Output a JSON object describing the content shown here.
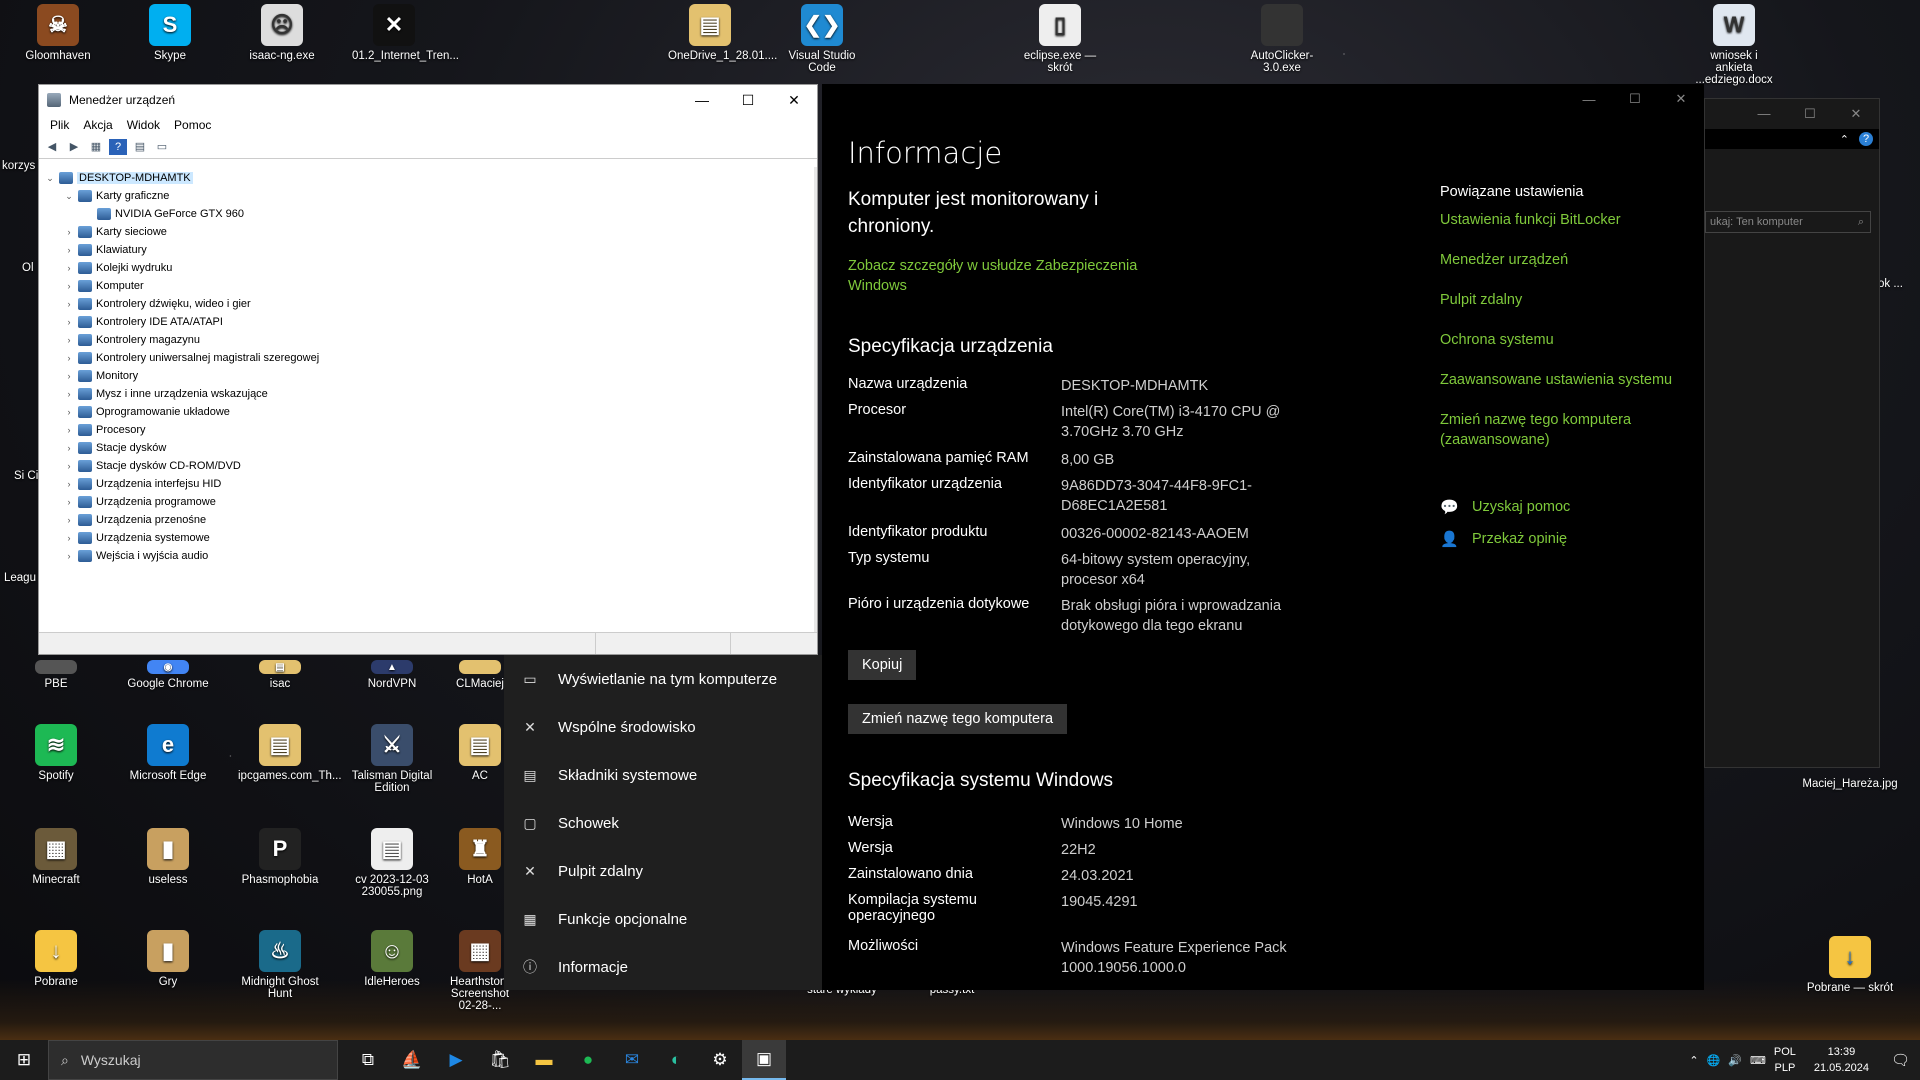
{
  "desktop": {
    "icons_top": [
      {
        "label": "Gloomhaven",
        "glyph": "☠"
      },
      {
        "label": "Skype",
        "glyph": "S"
      },
      {
        "label": "isaac-ng.exe",
        "glyph": "☹"
      },
      {
        "label": "01.2_Internet_Tren...",
        "glyph": "✕"
      },
      {
        "label": "OneDrive_1_28.01....",
        "glyph": "▤"
      },
      {
        "label": "Visual Studio Code",
        "glyph": "❮❯"
      },
      {
        "label": "eclipse.exe — skrót",
        "glyph": "▯"
      },
      {
        "label": "AutoClicker-3.0.exe",
        "glyph": ""
      },
      {
        "label": "wniosek i ankieta ...edziego.docx",
        "glyph": "W"
      }
    ],
    "icons_grid": [
      {
        "label": "PBE",
        "glyph": ""
      },
      {
        "label": "Google Chrome",
        "glyph": "◉"
      },
      {
        "label": "isac",
        "glyph": "▤"
      },
      {
        "label": "NordVPN",
        "glyph": "▲"
      },
      {
        "label": "CLMaciej",
        "glyph": ""
      },
      {
        "label": "Spotify",
        "glyph": "≋"
      },
      {
        "label": "Microsoft Edge",
        "glyph": "e"
      },
      {
        "label": "ipcgames.com_Th...",
        "glyph": "▤"
      },
      {
        "label": "Talisman Digital Edition",
        "glyph": "⚔"
      },
      {
        "label": "AC",
        "glyph": "▤"
      },
      {
        "label": "Minecraft",
        "glyph": "▦"
      },
      {
        "label": "useless",
        "glyph": "▮"
      },
      {
        "label": "Phasmophobia",
        "glyph": "P"
      },
      {
        "label": "cv 2023-12-03 230055.png",
        "glyph": "▤"
      },
      {
        "label": "HotA",
        "glyph": "♜"
      },
      {
        "label": "Pobrane",
        "glyph": "↓"
      },
      {
        "label": "Gry",
        "glyph": "▮"
      },
      {
        "label": "Midnight Ghost Hunt",
        "glyph": "♨"
      },
      {
        "label": "IdleHeroes",
        "glyph": "☺"
      },
      {
        "label": "Hearthstone Screenshot 02-28-...",
        "glyph": "▦"
      }
    ],
    "icons_bottom_misc": [
      {
        "label": "stare wykłady"
      },
      {
        "label": "passy.txt"
      }
    ],
    "icons_right": [
      {
        "label": "Maciej_Hareża.jpg"
      },
      {
        "label": "Pobrane — skrót",
        "glyph": "↓"
      }
    ],
    "edge_labels": [
      "korzys",
      "Ol",
      "Si Civ",
      "Leagu",
      "ok ..."
    ]
  },
  "devmgr": {
    "title": "Menedżer urządzeń",
    "menu": [
      "Plik",
      "Akcja",
      "Widok",
      "Pomoc"
    ],
    "tree": [
      {
        "label": "DESKTOP-MDHAMTK",
        "level": 0,
        "expanded": true,
        "selected": true
      },
      {
        "label": "Karty graficzne",
        "level": 1,
        "expanded": true
      },
      {
        "label": "NVIDIA GeForce GTX 960",
        "level": 2
      },
      {
        "label": "Karty sieciowe",
        "level": 1
      },
      {
        "label": "Klawiatury",
        "level": 1
      },
      {
        "label": "Kolejki wydruku",
        "level": 1
      },
      {
        "label": "Komputer",
        "level": 1
      },
      {
        "label": "Kontrolery dźwięku, wideo i gier",
        "level": 1
      },
      {
        "label": "Kontrolery IDE ATA/ATAPI",
        "level": 1
      },
      {
        "label": "Kontrolery magazynu",
        "level": 1
      },
      {
        "label": "Kontrolery uniwersalnej magistrali szeregowej",
        "level": 1
      },
      {
        "label": "Monitory",
        "level": 1
      },
      {
        "label": "Mysz i inne urządzenia wskazujące",
        "level": 1
      },
      {
        "label": "Oprogramowanie układowe",
        "level": 1
      },
      {
        "label": "Procesory",
        "level": 1
      },
      {
        "label": "Stacje dysków",
        "level": 1
      },
      {
        "label": "Stacje dysków CD-ROM/DVD",
        "level": 1
      },
      {
        "label": "Urządzenia interfejsu HID",
        "level": 1
      },
      {
        "label": "Urządzenia programowe",
        "level": 1
      },
      {
        "label": "Urządzenia przenośne",
        "level": 1
      },
      {
        "label": "Urządzenia systemowe",
        "level": 1
      },
      {
        "label": "Wejścia i wyjścia audio",
        "level": 1
      }
    ]
  },
  "settings": {
    "title": "Informacje",
    "protect_heading": "Komputer jest monitorowany i chroniony.",
    "protect_link": "Zobacz szczegóły w usłudze Zabezpieczenia Windows",
    "device_spec_heading": "Specyfikacja urządzenia",
    "device_spec": [
      {
        "k": "Nazwa urządzenia",
        "v": "DESKTOP-MDHAMTK"
      },
      {
        "k": "Procesor",
        "v": "Intel(R) Core(TM) i3-4170 CPU @ 3.70GHz   3.70 GHz"
      },
      {
        "k": "Zainstalowana pamięć RAM",
        "v": "8,00 GB"
      },
      {
        "k": "Identyfikator urządzenia",
        "v": "9A86DD73-3047-44F8-9FC1-D68EC1A2E581"
      },
      {
        "k": "Identyfikator produktu",
        "v": "00326-00002-82143-AAOEM"
      },
      {
        "k": "Typ systemu",
        "v": "64-bitowy system operacyjny, procesor x64"
      },
      {
        "k": "Pióro i urządzenia dotykowe",
        "v": "Brak obsługi pióra i wprowadzania dotykowego dla tego ekranu"
      }
    ],
    "copy_button": "Kopiuj",
    "rename_button": "Zmień nazwę tego komputera",
    "win_spec_heading": "Specyfikacja systemu Windows",
    "win_spec": [
      {
        "k": "Wersja",
        "v": "Windows 10 Home"
      },
      {
        "k": "Wersja",
        "v": "22H2"
      },
      {
        "k": "Zainstalowano dnia",
        "v": "24.03.2021"
      },
      {
        "k": "Kompilacja systemu operacyjnego",
        "v": "19045.4291"
      },
      {
        "k": "Możliwości",
        "v": "Windows Feature Experience Pack 1000.19056.1000.0"
      }
    ],
    "related_heading": "Powiązane ustawienia",
    "related_links": [
      "Ustawienia funkcji BitLocker",
      "Menedżer urządzeń",
      "Pulpit zdalny",
      "Ochrona systemu",
      "Zaawansowane ustawienia systemu",
      "Zmień nazwę tego komputera (zaawansowane)"
    ],
    "help_link": "Uzyskaj pomoc",
    "feedback_link": "Przekaż opinię",
    "nav": [
      {
        "label": "Wyświetlanie na tym komputerze",
        "icon": "▭"
      },
      {
        "label": "Wspólne środowisko",
        "icon": "✕"
      },
      {
        "label": "Składniki systemowe",
        "icon": "▤"
      },
      {
        "label": "Schowek",
        "icon": "▢"
      },
      {
        "label": "Pulpit zdalny",
        "icon": "✕"
      },
      {
        "label": "Funkcje opcjonalne",
        "icon": "▦"
      },
      {
        "label": "Informacje",
        "icon": "ⓘ"
      }
    ]
  },
  "explorer_back": {
    "search_placeholder": "ukaj: Ten komputer"
  },
  "taskbar": {
    "search_placeholder": "Wyszukaj",
    "lang1": "POL",
    "lang2": "PLP",
    "time": "13:39",
    "date": "21.05.2024"
  }
}
